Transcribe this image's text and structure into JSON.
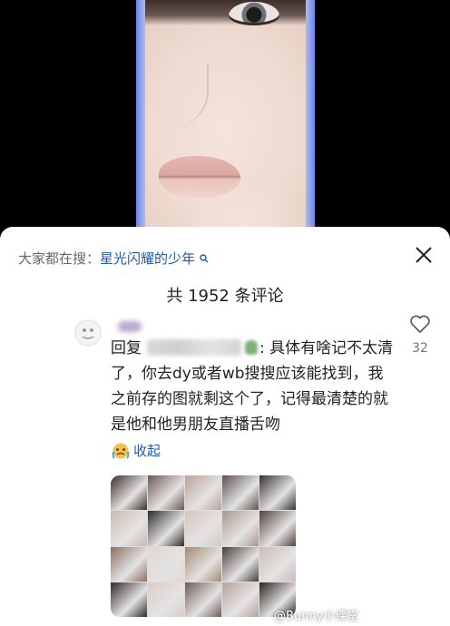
{
  "hot_search": {
    "prefix": "大家都在搜：",
    "keyword": "星光闪耀的少年"
  },
  "comments_header": {
    "title": "共 1952 条评论"
  },
  "comment": {
    "reply_prefix": "回复",
    "text": ": 具体有啥记不太清了，你去dy或者wb搜搜应该能找到，我之前存的图就剩这个了，记得最清楚的就是他和他男朋友直播舌吻",
    "like_count": "32",
    "collapse_label": "收起"
  },
  "watermark": {
    "text": "@Bunny小课堂"
  },
  "icons": {
    "close": "close-icon",
    "like": "heart-outline-icon",
    "collapse": "crying-face-icon",
    "search_magnifier": "search-icon"
  },
  "colors": {
    "link_blue": "#2659a8",
    "text_dark": "#222222",
    "text_gray": "#666666"
  },
  "image_grid": {
    "tile_colors": [
      "#3a2c28",
      "#6b5a52",
      "#b9a49a",
      "#5e5050",
      "#3b3238",
      "#c9b8b0",
      "#2f2a2c",
      "#d9c6bd",
      "#a8988e",
      "#54413b",
      "#8d6e62",
      "#e3d6cf",
      "#a4896f",
      "#4a3c3a",
      "#cbbcb3",
      "#33292a",
      "#dcccc6",
      "#6e5d58",
      "#b7a29a",
      "#2a2223"
    ]
  }
}
